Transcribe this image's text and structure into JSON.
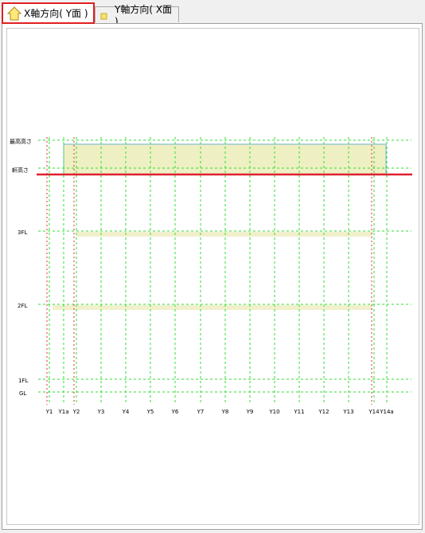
{
  "tabs": [
    {
      "label": "X軸方向( Y面 )",
      "icon": "house-icon",
      "active": true
    },
    {
      "label": "Y軸方向( X面 )",
      "icon": "small-square-icon",
      "active": false
    }
  ],
  "elevation": {
    "levels": [
      "最高高さ",
      "軒高さ",
      "3FL",
      "2FL",
      "1FL",
      "GL"
    ],
    "axes": [
      "Y1",
      "Y1a",
      "Y2",
      "Y3",
      "Y4",
      "Y5",
      "Y6",
      "Y7",
      "Y8",
      "Y9",
      "Y10",
      "Y11",
      "Y12",
      "Y13",
      "Y14",
      "Y14a"
    ],
    "colors": {
      "grid": "#33dd33",
      "highlight_axis": "#e03030",
      "eaves_line": "#e02030",
      "roof_fill": "#eef0c4",
      "roof_border": "#6fb3c8",
      "floor_fill": "#f1f0cc"
    }
  }
}
